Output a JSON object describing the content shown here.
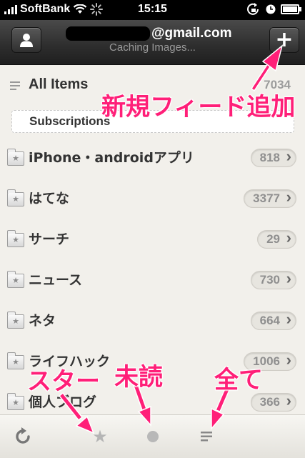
{
  "status_bar": {
    "carrier": "SoftBank",
    "time": "15:15"
  },
  "nav": {
    "account_email_visible": "@gmail.com",
    "subtitle": "Caching Images...",
    "add_label": "+"
  },
  "all_items": {
    "label": "All Items",
    "count": "7034"
  },
  "section_header": "Subscriptions",
  "feeds": [
    {
      "name": "iPhone・androidアプリ",
      "count": "818"
    },
    {
      "name": "はてな",
      "count": "3377"
    },
    {
      "name": "サーチ",
      "count": "29"
    },
    {
      "name": "ニュース",
      "count": "730"
    },
    {
      "name": "ネタ",
      "count": "664"
    },
    {
      "name": "ライフハック",
      "count": "1006"
    },
    {
      "name": "個人ブログ",
      "count": "366"
    }
  ],
  "annotations": {
    "new_feed": "新規フィード追加",
    "star": "スター",
    "unread": "未読",
    "all": "全て"
  },
  "colors": {
    "annotation": "#ff1f78",
    "navbar": "#2d2d2d",
    "background": "#f2f0eb"
  },
  "icons": {
    "user": "user-icon",
    "add": "plus-icon",
    "refresh": "refresh-icon",
    "star": "star-icon",
    "unread": "dot-icon",
    "all": "lines-icon",
    "folder": "folder-star-icon"
  }
}
